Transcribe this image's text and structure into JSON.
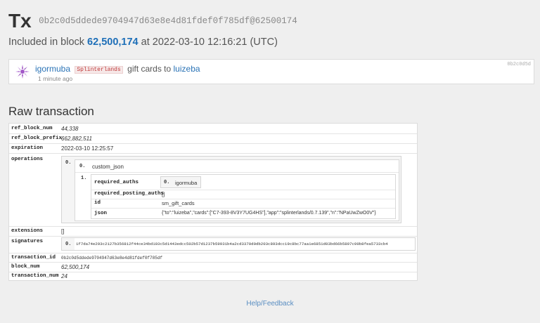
{
  "header": {
    "title": "Tx",
    "hash": "0b2c0d5ddede9704947d63e8e4d81fdef0f785df@62500174"
  },
  "included": {
    "prefix": "Included in block",
    "block": "62,500,174",
    "at": "at 2022-03-10 12:16:21 (UTC)"
  },
  "op_card": {
    "user": "igormuba",
    "app": "Splinterlands",
    "action": "gift cards to",
    "recipient": "luizeba",
    "time": "1 minute ago",
    "short_hash": "0b2c0d5d"
  },
  "section": {
    "title": "Raw transaction"
  },
  "raw": {
    "ref_block_num_key": "ref_block_num",
    "ref_block_num": "44,338",
    "ref_block_prefix_key": "ref_block_prefix",
    "ref_block_prefix": "662,882,511",
    "expiration_key": "expiration",
    "expiration": "2022-03-10 12:25:57",
    "operations_key": "operations",
    "op_index": "0.",
    "op_type_index": "0.",
    "op_type": "custom_json",
    "op_body_index": "1.",
    "required_auths_key": "required_auths",
    "required_auths_index": "0.",
    "required_auths_value": "igormuba",
    "required_posting_auths_key": "required_posting_auths",
    "required_posting_auths_value": "[]",
    "id_key": "id",
    "id_value": "sm_gift_cards",
    "json_key": "json",
    "json_value": "{\"to\":\"luizeba\",\"cards\":[\"C7-393-8V3Y7UG4HS\"],\"app\":\"splinterlands/0.7.139\",\"n\":\"NPaUwZwO0V\"}",
    "extensions_key": "extensions",
    "extensions": "[]",
    "signatures_key": "signatures",
    "signature_index": "0.",
    "signature": "1f7da74e293c2127b356812f44ce34bd103c5d1443edcc502b57d1237b59931b4a2cd3370d0db203c893dcc19c8bc77aa1e6851d03bd66b5897c99b8fea5733cb4",
    "transaction_id_key": "transaction_id",
    "transaction_id": "0b2c0d5ddede9704947d63e8e4d81fdef0f785df",
    "block_num_key": "block_num",
    "block_num": "62,500,174",
    "transaction_num_key": "transaction_num",
    "transaction_num": "24"
  },
  "footer": {
    "link": "Help/Feedback"
  }
}
